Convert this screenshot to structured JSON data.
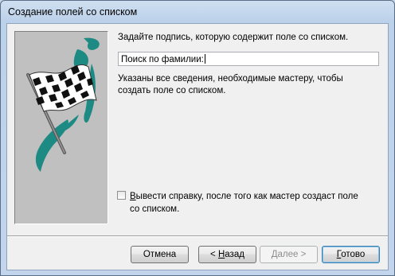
{
  "window": {
    "title": "Создание полей со списком"
  },
  "prompt": "Задайте подпись, которую содержит поле со списком.",
  "caption_field": {
    "value": "Поиск по фамилии:"
  },
  "info_text": "Указаны все сведения, необходимые мастеру, чтобы создать поле со списком.",
  "help_checkbox": {
    "checked": false,
    "label_first_letter": "В",
    "label_rest": "ывести справку, после того как мастер создаст поле со списком."
  },
  "buttons": {
    "cancel": "Отмена",
    "back_prefix": "< ",
    "back_mnemonic": "Н",
    "back_rest": "азад",
    "next_mnemonic": "Д",
    "next_rest": "алее >",
    "finish_mnemonic": "Г",
    "finish_rest": "отово"
  },
  "colors": {
    "flag_accent": "#1e8a84",
    "panel": "#c0c0c0"
  },
  "icons": {
    "wizard_image": "checkered-flag-icon"
  }
}
